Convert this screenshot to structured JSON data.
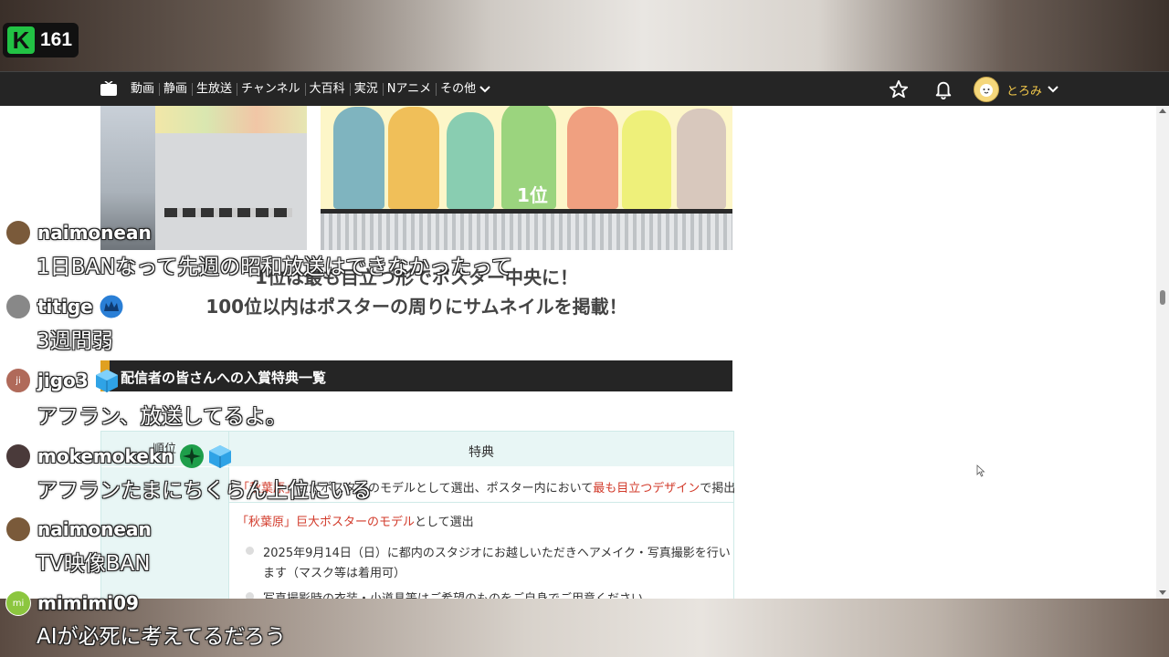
{
  "stream": {
    "viewer_count": "161",
    "platform_letter": "K",
    "platform_color": "#22c244"
  },
  "nav": {
    "items": [
      "動画",
      "静画",
      "生放送",
      "チャンネル",
      "大百科",
      "実況",
      "Nアニメ",
      "その他"
    ],
    "username": "とろみ"
  },
  "page": {
    "rank_label": "1位",
    "caption_line1": "1位は最も目立つ形でポスター中央に！",
    "caption_line2": "100位以内はポスターの周りにサムネイルを掲載！",
    "section_title": "配信者の皆さんへの入賞特典一覧",
    "table": {
      "header_rank": "順位",
      "header_benefit": "特典",
      "row1_red1": "「秋葉原」",
      "row1_text1": "巨大ポスターのモデルとして選出、ポスター内において",
      "row1_red2": "最も目立つデザイン",
      "row1_text2": "で掲出",
      "row2_red": "「秋葉原」巨大ポスターのモデル",
      "row2_text": "として選出",
      "bullet1_line1": "2025年9月14日（日）に都内のスタジオにお越しいただきヘアメイク・写真撮影を行い",
      "bullet1_line2": "ます（マスク等は着用可）",
      "bullet2": "写真撮影時の衣装・小道具等はご希望のものをご自身でご用意ください"
    }
  },
  "comments": [
    {
      "user": "naimonean",
      "text": "1日BANなって先週の昭和放送はできなかったって",
      "avatar_color": "#7a5a3a"
    },
    {
      "user": "titige",
      "text": "3週間弱",
      "avatar_color": "#888888"
    },
    {
      "user": "jigo3",
      "text": "アフラン、放送してるよ。",
      "avatar_color": "#b06a5a",
      "avatar_text": "ji"
    },
    {
      "user": "mokemokekn",
      "text": "アフランたまにちくらん上位にいる",
      "avatar_color": "#4a3a3a"
    },
    {
      "user": "naimonean",
      "text": "TV映像BAN",
      "avatar_color": "#7a5a3a"
    },
    {
      "user": "mimimi09",
      "text": "AIが必死に考えてるだろう",
      "avatar_color": "#8cc63f",
      "avatar_text": "mi"
    }
  ],
  "colors": {
    "accent_red": "#d23a2a",
    "username_gold": "#f0c64a",
    "section_accent": "#e0a020"
  }
}
